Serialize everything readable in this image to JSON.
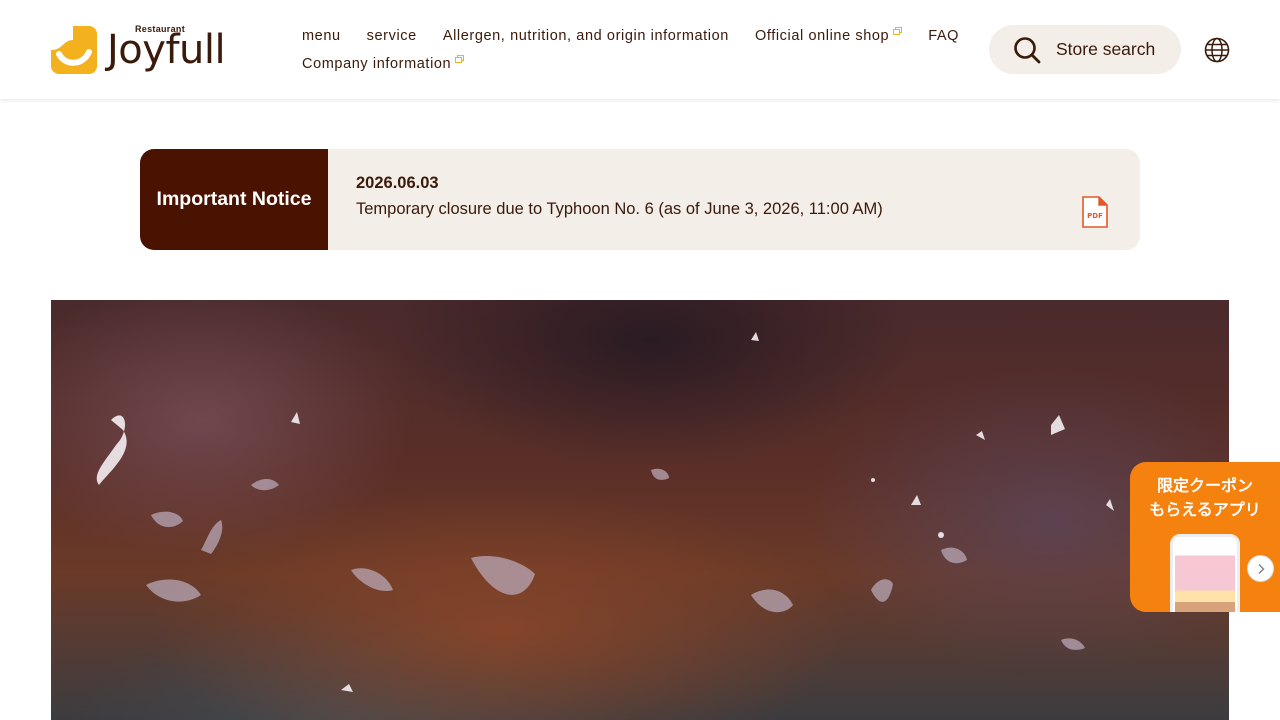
{
  "brand": {
    "logo_small_text": "Restaurant",
    "logo_text": "Joyfull",
    "accent_yellow": "#f4b11e",
    "brown": "#3a1a0a"
  },
  "nav": {
    "items": [
      {
        "label": "menu",
        "external": false
      },
      {
        "label": "service",
        "external": false
      },
      {
        "label": "Allergen, nutrition, and origin information",
        "external": false
      },
      {
        "label": "Official online shop",
        "external": true
      },
      {
        "label": "FAQ",
        "external": false
      },
      {
        "label": "Company information",
        "external": true
      }
    ]
  },
  "header_actions": {
    "store_search_label": "Store search",
    "store_search_icon": "search-icon",
    "language_icon": "globe-icon"
  },
  "notice": {
    "label": "Important Notice",
    "date": "2026.06.03",
    "text": "Temporary closure due to Typhoon No. 6 (as of June 3, 2026, 11:00 AM)",
    "attachment_icon": "pdf-icon",
    "attachment_label": "PDF",
    "label_bg": "#4a1200",
    "bg": "#f3eee8"
  },
  "hero": {
    "description_icon": "hamburger-steak-video"
  },
  "app_promo": {
    "text": "限定クーポン\nもらえるアプリ",
    "bg": "#f5810f",
    "next_icon": "chevron-right-icon"
  }
}
